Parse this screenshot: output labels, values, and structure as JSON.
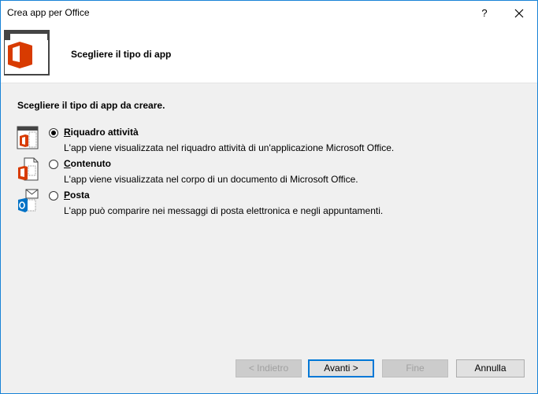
{
  "window": {
    "title": "Crea app per Office",
    "help_label": "?"
  },
  "header": {
    "title": "Scegliere il tipo di app"
  },
  "body": {
    "instruction": "Scegliere il tipo di app da creare.",
    "options": [
      {
        "label": "Riquadro attività",
        "mnemonic": "R",
        "rest": "iquadro attività",
        "description": "L'app viene visualizzata nel riquadro attività di un'applicazione Microsoft Office.",
        "selected": true,
        "icon": "task-pane-icon"
      },
      {
        "label": "Contenuto",
        "mnemonic": "C",
        "rest": "ontenuto",
        "description": "L'app viene visualizzata nel corpo di un documento di Microsoft Office.",
        "selected": false,
        "icon": "content-icon"
      },
      {
        "label": "Posta",
        "mnemonic": "P",
        "rest": "osta",
        "description": "L'app può comparire nei messaggi di posta elettronica e negli appuntamenti.",
        "selected": false,
        "icon": "mail-icon"
      }
    ]
  },
  "buttons": {
    "back": "< Indietro",
    "next": "Avanti >",
    "next_mnemonic": "v",
    "finish": "Fine",
    "cancel": "Annulla"
  },
  "colors": {
    "office_orange": "#d83b01",
    "accent_blue": "#0078d7",
    "outlook_blue": "#0072c6"
  }
}
